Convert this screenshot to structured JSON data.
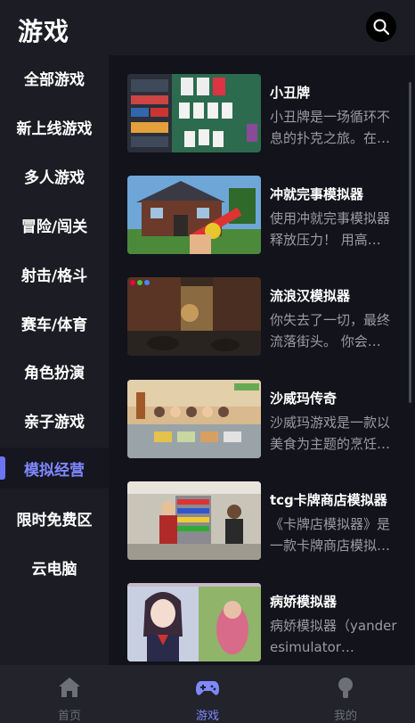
{
  "header": {
    "title": "游戏"
  },
  "sidebar": {
    "items": [
      {
        "label": "全部游戏"
      },
      {
        "label": "新上线游戏"
      },
      {
        "label": "多人游戏"
      },
      {
        "label": "冒险/闯关"
      },
      {
        "label": "射击/格斗"
      },
      {
        "label": "赛车/体育"
      },
      {
        "label": "角色扮演"
      },
      {
        "label": "亲子游戏"
      },
      {
        "label": "模拟经营",
        "active": true
      },
      {
        "label": "限时免费区"
      },
      {
        "label": "云电脑"
      }
    ]
  },
  "games": [
    {
      "name": "小丑牌",
      "desc": "小丑牌是一场循环不息的扑克之旅。在…"
    },
    {
      "name": "冲就完事模拟器",
      "desc": "使用冲就完事模拟器释放压力！ 用高…"
    },
    {
      "name": "流浪汉模拟器",
      "desc": "你失去了一切，最终流落街头。 你会…"
    },
    {
      "name": "沙威玛传奇",
      "desc": "沙威玛游戏是一款以美食为主题的烹饪…"
    },
    {
      "name": "tcg卡牌商店模拟器",
      "desc": "《卡牌店模拟器》是一款卡牌商店模拟…"
    },
    {
      "name": "病娇模拟器",
      "desc": "病娇模拟器（yanderesimulator…"
    }
  ],
  "tabbar": {
    "tabs": [
      {
        "label": "首页",
        "icon": "home-icon"
      },
      {
        "label": "游戏",
        "icon": "gamepad-icon",
        "active": true
      },
      {
        "label": "我的",
        "icon": "profile-icon"
      }
    ]
  },
  "colors": {
    "accent": "#7f88ff",
    "background": "#1c1d24",
    "content_background": "#12131b"
  }
}
